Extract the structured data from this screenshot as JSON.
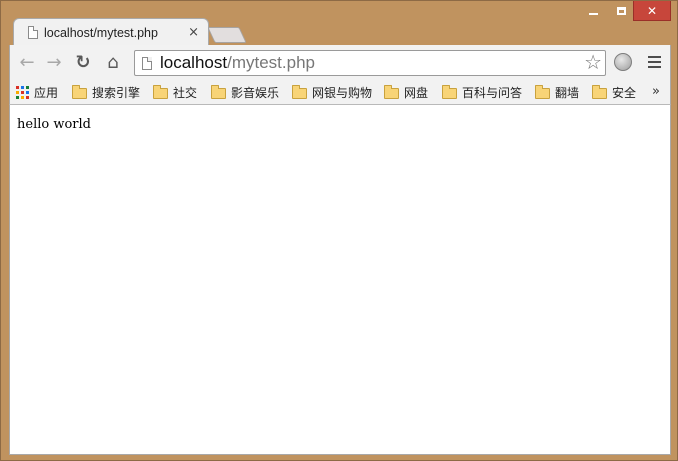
{
  "window": {
    "minimize_label": "",
    "maximize_label": "",
    "close_label": "✕"
  },
  "tab": {
    "title": "localhost/mytest.php",
    "close_label": "×"
  },
  "toolbar": {
    "back": "←",
    "forward": "→",
    "reload": "↻",
    "home": "⌂",
    "url_host": "localhost",
    "url_path": "/mytest.php",
    "star": "☆"
  },
  "bookmarks": {
    "apps_label": "应用",
    "items": [
      "搜索引擎",
      "社交",
      "影音娱乐",
      "网银与购物",
      "网盘",
      "百科与问答",
      "翻墙",
      "安全"
    ],
    "more_label": "»"
  },
  "page": {
    "text": "hello world"
  },
  "colors": {
    "window_frame": "#c0935f",
    "close_button": "#c7463b",
    "folder": "#f8d477"
  },
  "icons": {
    "tab_icon": "document-icon",
    "bookmark_icon": "folder-icon"
  }
}
